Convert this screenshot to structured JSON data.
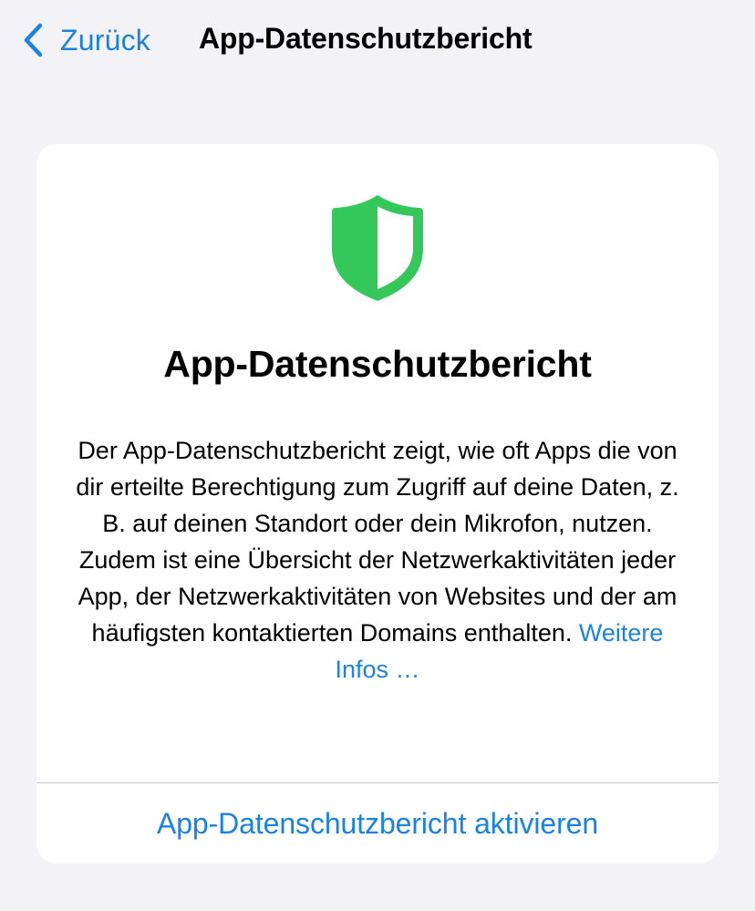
{
  "nav": {
    "back_label": "Zurück",
    "title": "App-Datenschutzbericht"
  },
  "card": {
    "icon": "shield-icon",
    "title": "App-Datenschutzbericht",
    "description": "Der App-Datenschutzbericht zeigt, wie oft Apps die von dir erteilte Berechtigung zum Zugriff auf deine Daten, z. B. auf deinen Standort oder dein Mikrofon, nutzen. Zudem ist eine Übersicht der Netzwerkaktivitäten jeder App, der Netzwerkaktivitäten von Websites und der am häufigsten kontaktierten Domains enthalten.",
    "more_link": "Weitere Infos …",
    "activate_label": "App-Datenschutzbericht aktivieren"
  },
  "colors": {
    "accent": "#1a82e4",
    "shield_green": "#34c759",
    "background": "#f2f2f7",
    "card": "#ffffff"
  }
}
